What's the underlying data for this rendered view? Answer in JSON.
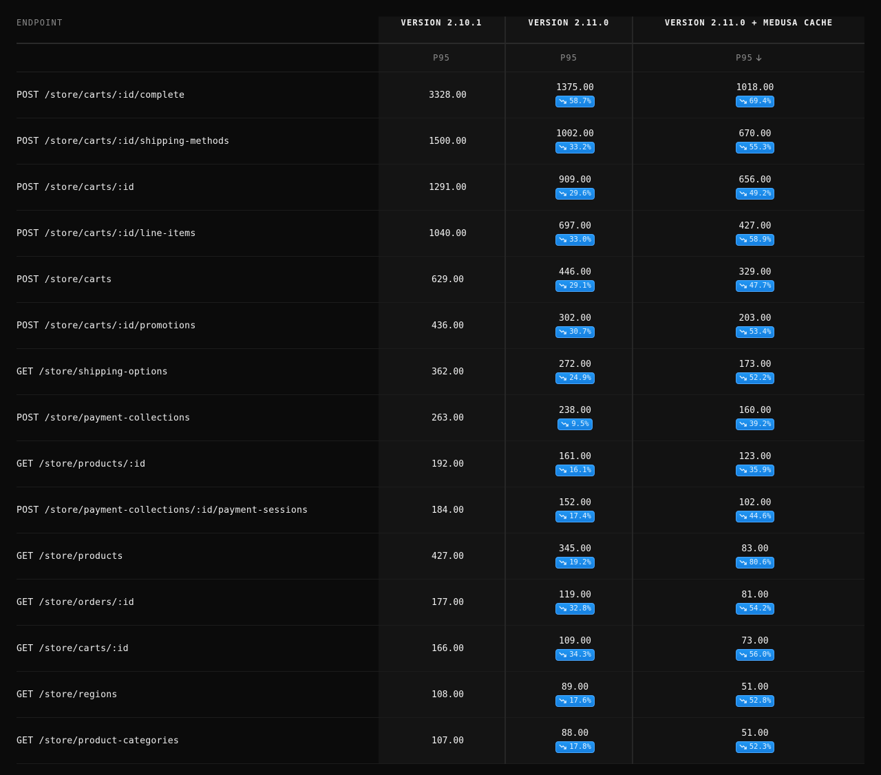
{
  "headers": {
    "endpoint": "ENDPOINT",
    "v1": "VERSION 2.10.1",
    "v2": "VERSION 2.11.0",
    "v3": "VERSION 2.11.0 + MEDUSA CACHE"
  },
  "subheaders": {
    "v1": "P95",
    "v2": "P95",
    "v3": "P95"
  },
  "colors": {
    "badge": "#1a8cff",
    "background": "#0b0b0b"
  },
  "rows": [
    {
      "endpoint": "POST /store/carts/:id/complete",
      "v1": "3328.00",
      "v2": "1375.00",
      "v2_change": "58.7%",
      "v3": "1018.00",
      "v3_change": "69.4%"
    },
    {
      "endpoint": "POST /store/carts/:id/shipping-methods",
      "v1": "1500.00",
      "v2": "1002.00",
      "v2_change": "33.2%",
      "v3": "670.00",
      "v3_change": "55.3%"
    },
    {
      "endpoint": "POST /store/carts/:id",
      "v1": "1291.00",
      "v2": "909.00",
      "v2_change": "29.6%",
      "v3": "656.00",
      "v3_change": "49.2%"
    },
    {
      "endpoint": "POST /store/carts/:id/line-items",
      "v1": "1040.00",
      "v2": "697.00",
      "v2_change": "33.0%",
      "v3": "427.00",
      "v3_change": "58.9%"
    },
    {
      "endpoint": "POST /store/carts",
      "v1": "629.00",
      "v2": "446.00",
      "v2_change": "29.1%",
      "v3": "329.00",
      "v3_change": "47.7%"
    },
    {
      "endpoint": "POST /store/carts/:id/promotions",
      "v1": "436.00",
      "v2": "302.00",
      "v2_change": "30.7%",
      "v3": "203.00",
      "v3_change": "53.4%"
    },
    {
      "endpoint": "GET /store/shipping-options",
      "v1": "362.00",
      "v2": "272.00",
      "v2_change": "24.9%",
      "v3": "173.00",
      "v3_change": "52.2%"
    },
    {
      "endpoint": "POST /store/payment-collections",
      "v1": "263.00",
      "v2": "238.00",
      "v2_change": "9.5%",
      "v3": "160.00",
      "v3_change": "39.2%"
    },
    {
      "endpoint": "GET /store/products/:id",
      "v1": "192.00",
      "v2": "161.00",
      "v2_change": "16.1%",
      "v3": "123.00",
      "v3_change": "35.9%"
    },
    {
      "endpoint": "POST /store/payment-collections/:id/payment-sessions",
      "v1": "184.00",
      "v2": "152.00",
      "v2_change": "17.4%",
      "v3": "102.00",
      "v3_change": "44.6%"
    },
    {
      "endpoint": "GET /store/products",
      "v1": "427.00",
      "v2": "345.00",
      "v2_change": "19.2%",
      "v3": "83.00",
      "v3_change": "80.6%"
    },
    {
      "endpoint": "GET /store/orders/:id",
      "v1": "177.00",
      "v2": "119.00",
      "v2_change": "32.8%",
      "v3": "81.00",
      "v3_change": "54.2%"
    },
    {
      "endpoint": "GET /store/carts/:id",
      "v1": "166.00",
      "v2": "109.00",
      "v2_change": "34.3%",
      "v3": "73.00",
      "v3_change": "56.0%"
    },
    {
      "endpoint": "GET /store/regions",
      "v1": "108.00",
      "v2": "89.00",
      "v2_change": "17.6%",
      "v3": "51.00",
      "v3_change": "52.8%"
    },
    {
      "endpoint": "GET /store/product-categories",
      "v1": "107.00",
      "v2": "88.00",
      "v2_change": "17.8%",
      "v3": "51.00",
      "v3_change": "52.3%"
    }
  ]
}
